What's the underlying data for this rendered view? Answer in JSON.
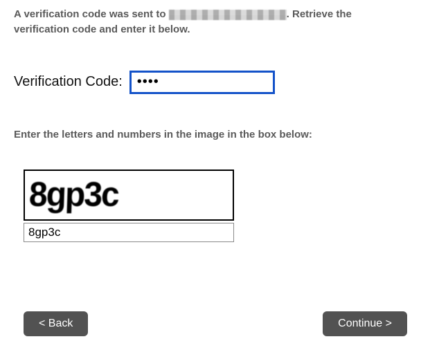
{
  "instruction": {
    "prefix": "A verification code was sent to ",
    "suffix": ". Retrieve the verification code and enter it below."
  },
  "verification": {
    "label": "Verification Code:",
    "value": "••••"
  },
  "captcha": {
    "prompt": "Enter the letters and numbers in the image in the box below:",
    "image_text": "8gp3c",
    "input_value": "8gp3c"
  },
  "buttons": {
    "back": "< Back",
    "continue": "Continue >"
  }
}
